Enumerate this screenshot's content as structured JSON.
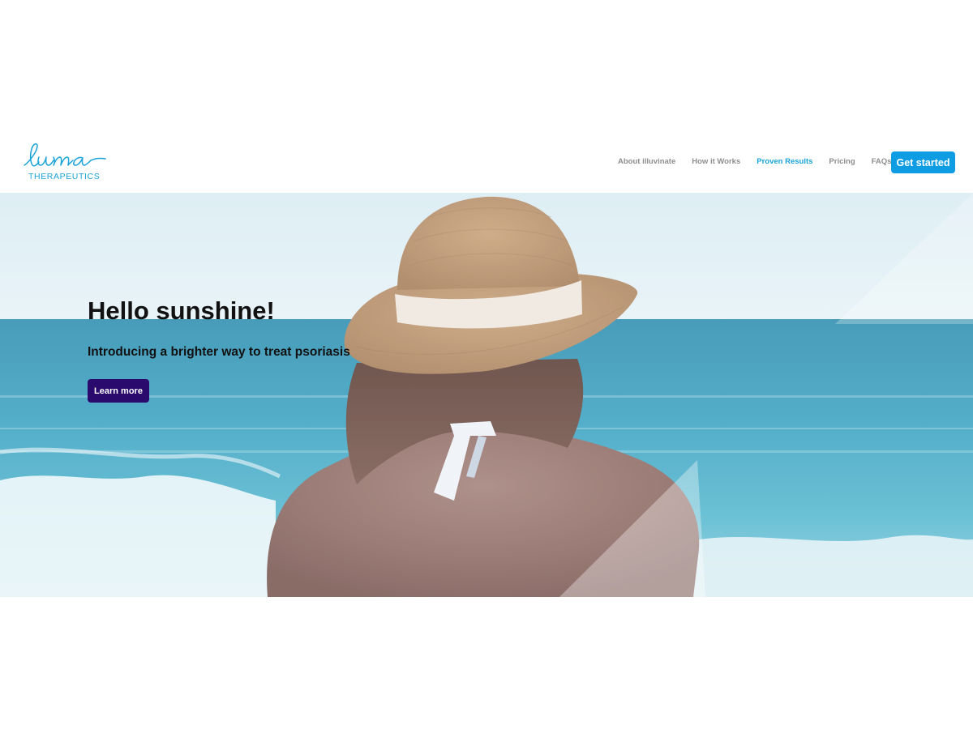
{
  "brand": {
    "logo_script": "luma",
    "logo_sub": "THERAPEUTICS",
    "logo_mark": "™"
  },
  "nav": {
    "items": [
      {
        "label": "About illuvinate",
        "active": false
      },
      {
        "label": "How it Works",
        "active": false
      },
      {
        "label": "Proven Results",
        "active": true
      },
      {
        "label": "Pricing",
        "active": false
      },
      {
        "label": "FAQs",
        "active": false
      }
    ],
    "cta_label": "Get started"
  },
  "hero": {
    "title": "Hello sunshine!",
    "subtitle": "Introducing a brighter way to treat psoriasis",
    "button_label": "Learn more",
    "image_subject": "woman-in-straw-hat-facing-sea"
  },
  "colors": {
    "accent": "#1aa3d8",
    "cta": "#0e9de3",
    "hero_button": "#2b0a6e",
    "nav_text": "#8e8e8e",
    "heading_text": "#111111"
  }
}
